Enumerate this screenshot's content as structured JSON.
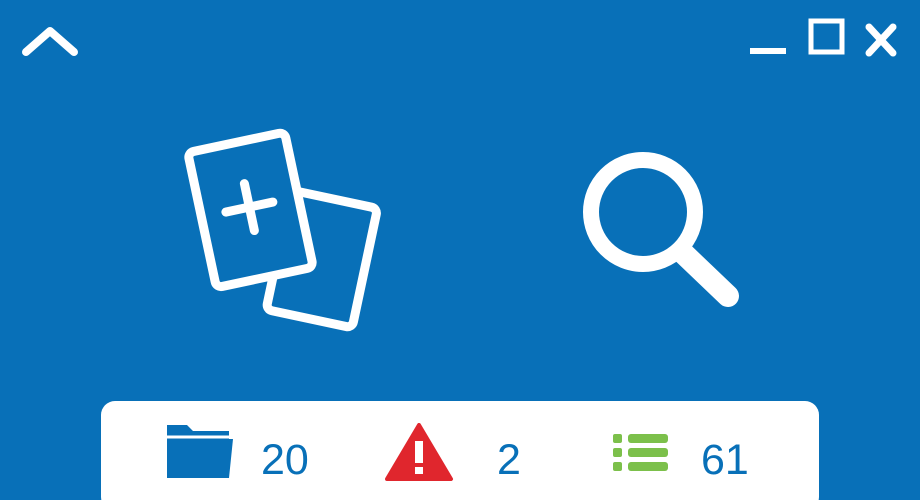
{
  "titlebar": {
    "icons": {
      "collapse": "chevron-up-icon",
      "minimize": "minimize-icon",
      "maximize": "maximize-icon",
      "close": "close-icon"
    }
  },
  "actions": {
    "new_document_icon": "new-document-icon",
    "search_icon": "search-icon"
  },
  "status": {
    "folders": {
      "icon": "folder-icon",
      "value": "20",
      "color": "#0870b8"
    },
    "warnings": {
      "icon": "warning-icon",
      "value": "2",
      "color": "#e0262d"
    },
    "lists": {
      "icon": "list-icon",
      "value": "61",
      "color": "#7cc04b"
    }
  },
  "colors": {
    "background": "#0870b8",
    "panel": "#ffffff",
    "icon": "#ffffff",
    "value_text": "#0870b8"
  }
}
